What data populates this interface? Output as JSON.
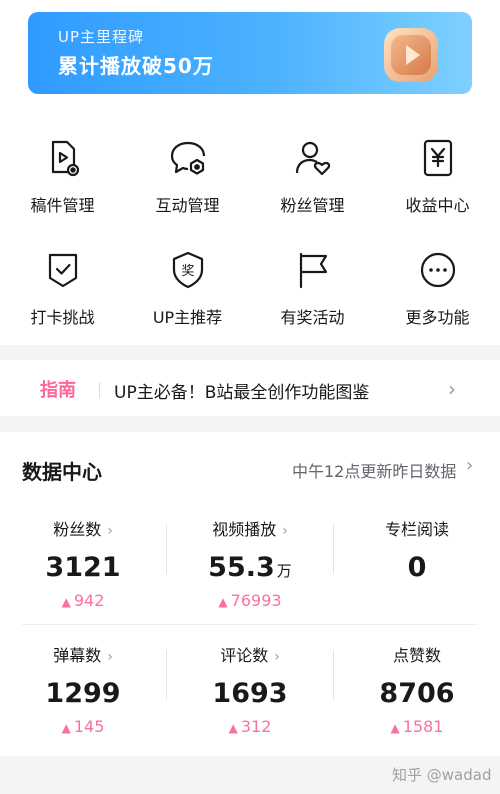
{
  "banner": {
    "subtitle": "UP主里程碑",
    "title": "累计播放破50万"
  },
  "tools": [
    {
      "label": "稿件管理",
      "icon": "manuscript-icon"
    },
    {
      "label": "互动管理",
      "icon": "interaction-icon"
    },
    {
      "label": "粉丝管理",
      "icon": "fans-icon"
    },
    {
      "label": "收益中心",
      "icon": "earnings-icon"
    },
    {
      "label": "打卡挑战",
      "icon": "checkin-icon"
    },
    {
      "label": "UP主推荐",
      "icon": "award-icon"
    },
    {
      "label": "有奖活动",
      "icon": "flag-icon"
    },
    {
      "label": "更多功能",
      "icon": "more-icon"
    }
  ],
  "guide": {
    "tag": "指南",
    "text": "UP主必备！B站最全创作功能图鉴"
  },
  "data_center": {
    "title": "数据中心",
    "note": "中午12点更新昨日数据",
    "stats": [
      {
        "label": "粉丝数",
        "value": "3121",
        "unit": "",
        "delta": "942"
      },
      {
        "label": "视频播放",
        "value": "55.3",
        "unit": "万",
        "delta": "76993"
      },
      {
        "label": "专栏阅读",
        "value": "0",
        "unit": "",
        "delta": ""
      },
      {
        "label": "弹幕数",
        "value": "1299",
        "unit": "",
        "delta": "145"
      },
      {
        "label": "评论数",
        "value": "1693",
        "unit": "",
        "delta": "312"
      },
      {
        "label": "点赞数",
        "value": "8706",
        "unit": "",
        "delta": "1581"
      }
    ]
  },
  "watermark": "知乎 @wadad",
  "colors": {
    "accent": "#fb7299",
    "guide_tag": "#ff6699",
    "banner": "#3ea6ff"
  }
}
